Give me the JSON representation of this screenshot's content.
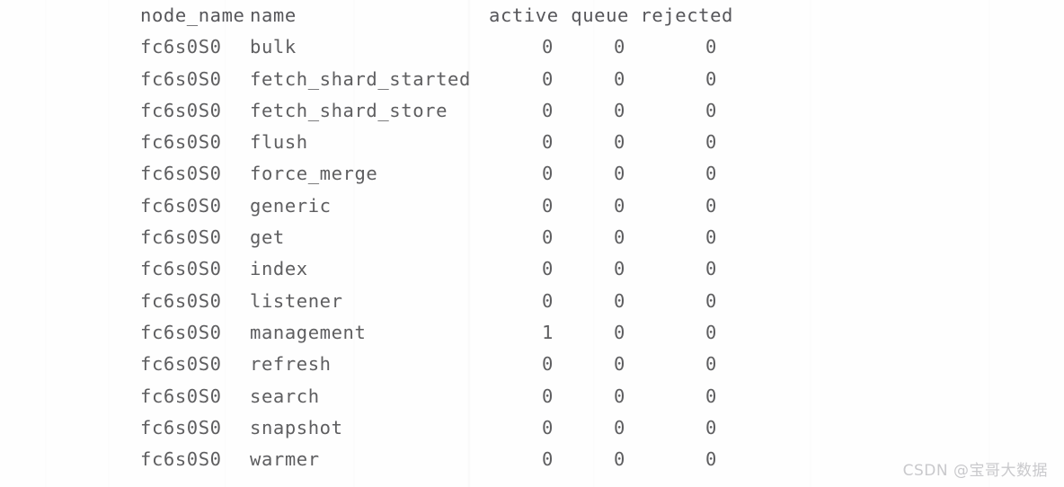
{
  "terminal": {
    "columns": {
      "node_name": "node_name",
      "name": "name",
      "active": "active",
      "queue": "queue",
      "rejected": "rejected"
    },
    "rows": [
      {
        "node_name": "fc6s0S0",
        "name": "bulk",
        "active": "0",
        "queue": "0",
        "rejected": "0"
      },
      {
        "node_name": "fc6s0S0",
        "name": "fetch_shard_started",
        "active": "0",
        "queue": "0",
        "rejected": "0"
      },
      {
        "node_name": "fc6s0S0",
        "name": "fetch_shard_store",
        "active": "0",
        "queue": "0",
        "rejected": "0"
      },
      {
        "node_name": "fc6s0S0",
        "name": "flush",
        "active": "0",
        "queue": "0",
        "rejected": "0"
      },
      {
        "node_name": "fc6s0S0",
        "name": "force_merge",
        "active": "0",
        "queue": "0",
        "rejected": "0"
      },
      {
        "node_name": "fc6s0S0",
        "name": "generic",
        "active": "0",
        "queue": "0",
        "rejected": "0"
      },
      {
        "node_name": "fc6s0S0",
        "name": "get",
        "active": "0",
        "queue": "0",
        "rejected": "0"
      },
      {
        "node_name": "fc6s0S0",
        "name": "index",
        "active": "0",
        "queue": "0",
        "rejected": "0"
      },
      {
        "node_name": "fc6s0S0",
        "name": "listener",
        "active": "0",
        "queue": "0",
        "rejected": "0"
      },
      {
        "node_name": "fc6s0S0",
        "name": "management",
        "active": "1",
        "queue": "0",
        "rejected": "0"
      },
      {
        "node_name": "fc6s0S0",
        "name": "refresh",
        "active": "0",
        "queue": "0",
        "rejected": "0"
      },
      {
        "node_name": "fc6s0S0",
        "name": "search",
        "active": "0",
        "queue": "0",
        "rejected": "0"
      },
      {
        "node_name": "fc6s0S0",
        "name": "snapshot",
        "active": "0",
        "queue": "0",
        "rejected": "0"
      },
      {
        "node_name": "fc6s0S0",
        "name": "warmer",
        "active": "0",
        "queue": "0",
        "rejected": "0"
      }
    ]
  },
  "watermark": {
    "text": "CSDN @宝哥大数据"
  },
  "colors": {
    "background": "#fefefe",
    "text": "#5e5e60",
    "watermark": "#c9c9cc"
  }
}
